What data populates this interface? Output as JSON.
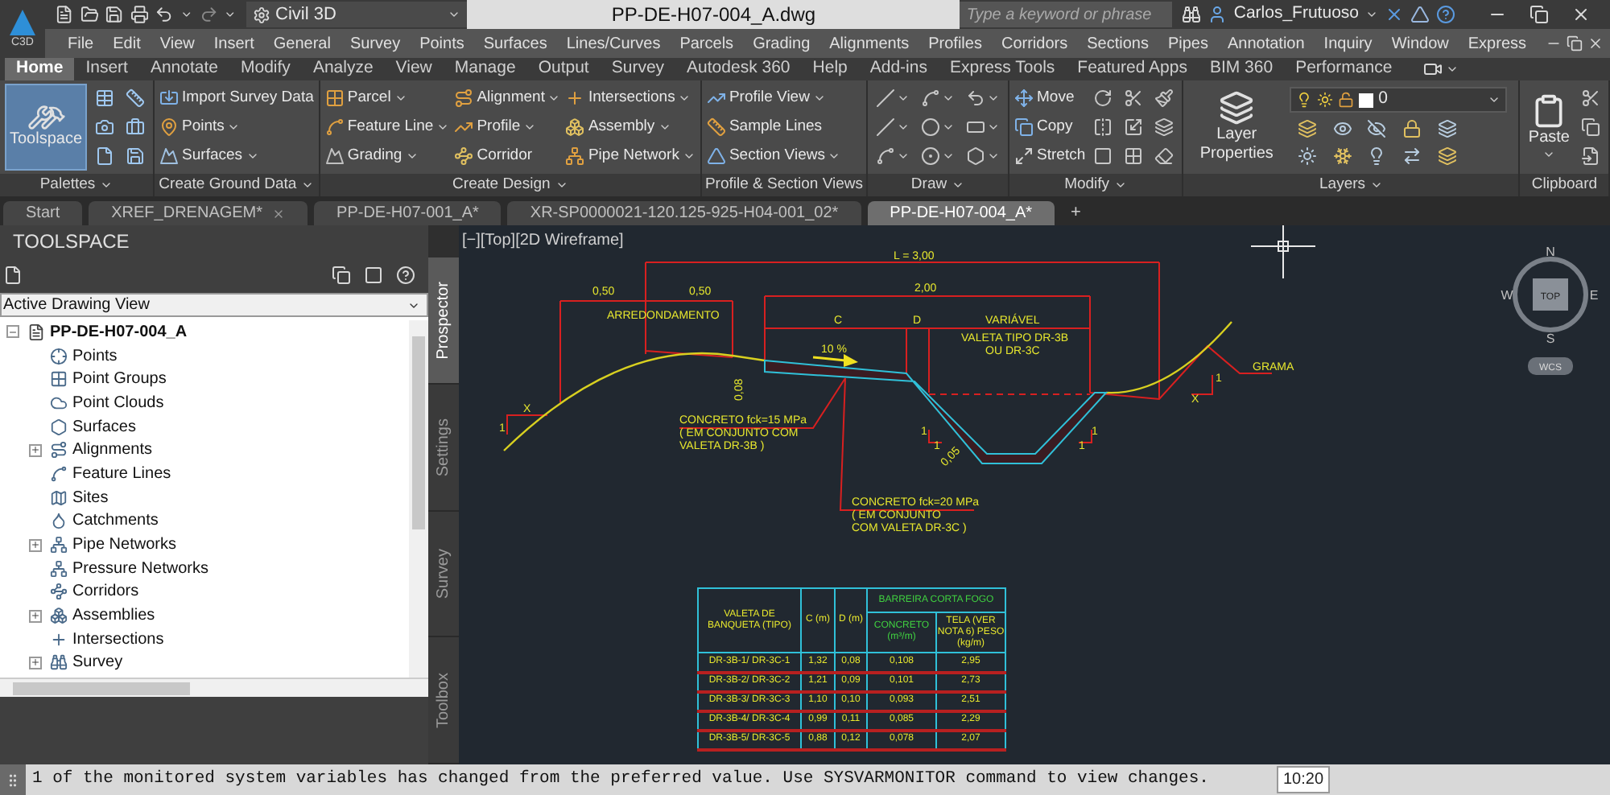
{
  "title_bar": {
    "app_label": "C3D",
    "workspace": "Civil 3D",
    "title": "PP-DE-H07-004_A.dwg",
    "search": {
      "placeholder": "Type a keyword or phrase"
    },
    "user": "Carlos_Frutuoso"
  },
  "menu_bar": [
    "File",
    "Edit",
    "View",
    "Insert",
    "General",
    "Survey",
    "Points",
    "Surfaces",
    "Lines/Curves",
    "Parcels",
    "Grading",
    "Alignments",
    "Profiles",
    "Corridors",
    "Sections",
    "Pipes",
    "Annotation",
    "Inquiry",
    "Window",
    "Express"
  ],
  "ribbon_tabs": [
    {
      "label": "Home",
      "selected": true
    },
    {
      "label": "Insert",
      "selected": false
    },
    {
      "label": "Annotate",
      "selected": false
    },
    {
      "label": "Modify",
      "selected": false
    },
    {
      "label": "Analyze",
      "selected": false
    },
    {
      "label": "View",
      "selected": false
    },
    {
      "label": "Manage",
      "selected": false
    },
    {
      "label": "Output",
      "selected": false
    },
    {
      "label": "Survey",
      "selected": false
    },
    {
      "label": "Autodesk 360",
      "selected": false
    },
    {
      "label": "Help",
      "selected": false
    },
    {
      "label": "Add-ins",
      "selected": false
    },
    {
      "label": "Express Tools",
      "selected": false
    },
    {
      "label": "Featured Apps",
      "selected": false
    },
    {
      "label": "BIM 360",
      "selected": false
    },
    {
      "label": "Performance",
      "selected": false
    }
  ],
  "ribbon_panels": [
    {
      "title": "Palettes",
      "menu": true,
      "items": [
        {
          "kind": "large",
          "label": "Toolspace",
          "menu": false,
          "selected": true
        }
      ]
    },
    {
      "title": "Create Ground Data",
      "menu": true,
      "items": [
        {
          "kind": "small",
          "label": "Import Survey Data",
          "menu": false
        },
        {
          "kind": "small",
          "label": "Points",
          "menu": true
        },
        {
          "kind": "small",
          "label": "Surfaces",
          "menu": true
        }
      ]
    },
    {
      "title": "Create Design",
      "menu": true,
      "items": [
        {
          "kind": "small",
          "label": "Parcel",
          "menu": true
        },
        {
          "kind": "small",
          "label": "Feature Line",
          "menu": true
        },
        {
          "kind": "small",
          "label": "Grading",
          "menu": true
        },
        {
          "kind": "small",
          "label": "Alignment",
          "menu": true
        },
        {
          "kind": "small",
          "label": "Profile",
          "menu": true
        },
        {
          "kind": "small",
          "label": "Corridor",
          "menu": false
        },
        {
          "kind": "small",
          "label": "Intersections",
          "menu": true
        },
        {
          "kind": "small",
          "label": "Assembly",
          "menu": true
        },
        {
          "kind": "small",
          "label": "Pipe Network",
          "menu": true
        }
      ]
    },
    {
      "title": "Profile & Section Views",
      "menu": false,
      "items": [
        {
          "kind": "small",
          "label": "Profile View",
          "menu": true
        },
        {
          "kind": "small",
          "label": "Sample Lines",
          "menu": false
        },
        {
          "kind": "small",
          "label": "Section Views",
          "menu": true
        }
      ]
    },
    {
      "title": "Draw",
      "menu": true
    },
    {
      "title": "Modify",
      "menu": true,
      "items": [
        {
          "kind": "small",
          "label": "Move",
          "menu": false
        },
        {
          "kind": "small",
          "label": "Copy",
          "menu": false
        },
        {
          "kind": "small",
          "label": "Stretch",
          "menu": false
        }
      ]
    },
    {
      "title": "Layers",
      "menu": true,
      "items": [
        {
          "kind": "large",
          "label": "Layer Properties",
          "menu": false,
          "selected": false
        },
        {
          "kind": "layer_select",
          "value": "0"
        }
      ]
    },
    {
      "title": "Clipboard",
      "menu": false,
      "items": [
        {
          "kind": "large",
          "label": "Paste",
          "menu": true,
          "selected": false
        }
      ]
    }
  ],
  "document_tabs": {
    "tabs": [
      {
        "label": "Start",
        "selected": false,
        "closable": false
      },
      {
        "label": "XREF_DRENAGEM*",
        "selected": false,
        "closable": true
      },
      {
        "label": "PP-DE-H07-001_A*",
        "selected": false,
        "closable": false
      },
      {
        "label": "XR-SP0000021-120.125-925-H04-001_02*",
        "selected": false,
        "closable": false
      },
      {
        "label": "PP-DE-H07-004_A*",
        "selected": true,
        "closable": false
      }
    ],
    "new_tab": "+"
  },
  "toolspace": {
    "title": "TOOLSPACE",
    "view": "Active Drawing View",
    "tree": [
      {
        "label": "PP-DE-H07-004_A",
        "expanded": true,
        "children": [
          {
            "label": "Points"
          },
          {
            "label": "Point Groups"
          },
          {
            "label": "Point Clouds"
          },
          {
            "label": "Surfaces"
          },
          {
            "label": "Alignments",
            "expanded": false
          },
          {
            "label": "Feature Lines"
          },
          {
            "label": "Sites"
          },
          {
            "label": "Catchments"
          },
          {
            "label": "Pipe Networks",
            "expanded": false
          },
          {
            "label": "Pressure Networks"
          },
          {
            "label": "Corridors"
          },
          {
            "label": "Assemblies",
            "expanded": false
          },
          {
            "label": "Intersections"
          },
          {
            "label": "Survey",
            "expanded": false
          }
        ]
      }
    ],
    "side_tabs": [
      {
        "label": "Prospector",
        "selected": true
      },
      {
        "label": "Settings",
        "selected": false
      },
      {
        "label": "Survey",
        "selected": false
      },
      {
        "label": "Toolbox",
        "selected": false
      }
    ]
  },
  "viewport": {
    "label": "[−][Top][2D Wireframe]",
    "viewcube": {
      "north": "N",
      "south": "S",
      "east": "E",
      "west": "W",
      "face": "TOP",
      "ucs": "WCS"
    },
    "drawing": {
      "labels": [
        "L = 3,00",
        "0,50",
        "0,50",
        "ARREDONDAMENTO",
        "2,00",
        "C",
        "D",
        "VARIÁVEL",
        "VALETA TIPO DR-3B",
        "OU DR-3C",
        "10 %",
        "0,08",
        "CONCRETO fck=15 MPa",
        "( EM CONJUNTO COM",
        "VALETA DR-3B )",
        "CONCRETO fck=20 MPa",
        "( EM CONJUNTO",
        "COM VALETA DR-3C )",
        "0,05",
        "X",
        "1",
        "1",
        "1",
        "1",
        "1",
        "X",
        "1",
        "GRAMA"
      ]
    },
    "table": {
      "header": [
        "VALETA DE BANQUETA (TIPO)",
        "C (m)",
        "D (m)"
      ],
      "group": "BARREIRA CORTA FOGO",
      "sub_headers": [
        "CONCRETO (m³/m)",
        "TELA (VER NOTA 6) PESO (kg/m)"
      ],
      "rows": [
        [
          "DR-3B-1/ DR-3C-1",
          "1,32",
          "0,08",
          "0,108",
          "2,95"
        ],
        [
          "DR-3B-2/ DR-3C-2",
          "1,21",
          "0,09",
          "0,101",
          "2,73"
        ],
        [
          "DR-3B-3/ DR-3C-3",
          "1,10",
          "0,10",
          "0,093",
          "2,51"
        ],
        [
          "DR-3B-4/ DR-3C-4",
          "0,99",
          "0,11",
          "0,085",
          "2,29"
        ],
        [
          "DR-3B-5/ DR-3C-5",
          "0,88",
          "0,12",
          "0,078",
          "2,07"
        ]
      ]
    }
  },
  "command_line": {
    "message": "1 of the monitored system variables has changed from the preferred value. Use SYSVARMONITOR command to view changes.",
    "tooltip": "10:20"
  }
}
